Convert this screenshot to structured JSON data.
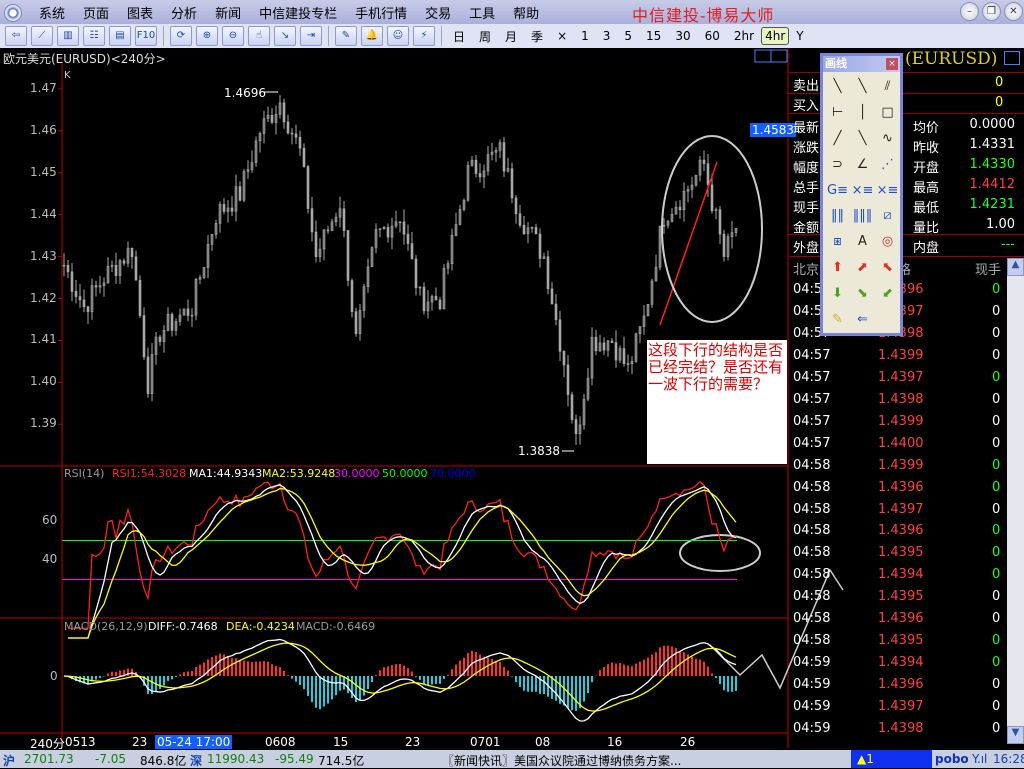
{
  "app": {
    "title": "中信建投-博易大师",
    "menu": [
      "系统",
      "页面",
      "图表",
      "分析",
      "新闻",
      "中信建投专栏",
      "手机行情",
      "交易",
      "工具",
      "帮助"
    ]
  },
  "toolbar": {
    "icons": [
      "back-icon",
      "line-chart-icon",
      "kline-icon",
      "table-icon",
      "report-icon",
      "f10-icon",
      "refresh-icon",
      "zoom-in-icon",
      "zoom-out-icon",
      "cursor-icon",
      "window-arrow-icon",
      "export-icon",
      "draw-icon",
      "alarm-icon",
      "users-icon",
      "lightning-icon"
    ],
    "f10_label": "F10",
    "periods": [
      "日",
      "周",
      "月",
      "季",
      "×",
      "1",
      "3",
      "5",
      "15",
      "30",
      "60",
      "2hr",
      "4hr",
      "Y"
    ],
    "selected_period": "4hr"
  },
  "chart": {
    "symbol_title": "欧元美元(EURUSD)<240分>",
    "k_label": "K",
    "y_ticks": [
      "1.47",
      "1.46",
      "1.45",
      "1.44",
      "1.43",
      "1.42",
      "1.41",
      "1.40",
      "1.39"
    ],
    "high_label": "1.4696",
    "low_label": "1.3838",
    "last_price_tag": "1.4583",
    "x_period_label": "240分",
    "x_ticks": [
      "0513",
      "23",
      "05-24 17:00",
      "0608",
      "15",
      "23",
      "0701",
      "08",
      "16",
      "26"
    ],
    "annotation": "这段下行的结构是否已经完结？是否还有一波下行的需要？",
    "colors": {
      "candle": "#a8a8a8",
      "axis": "#c00000",
      "trendline": "#ff2020"
    }
  },
  "chart_data": {
    "type": "candlestick",
    "note_points": "approximate price path (bar index, price)",
    "waypoints": [
      [
        0,
        1.428
      ],
      [
        5,
        1.418
      ],
      [
        10,
        1.425
      ],
      [
        17,
        1.432
      ],
      [
        21,
        1.4
      ],
      [
        24,
        1.412
      ],
      [
        32,
        1.418
      ],
      [
        38,
        1.44
      ],
      [
        44,
        1.445
      ],
      [
        49,
        1.46
      ],
      [
        54,
        1.467
      ],
      [
        59,
        1.455
      ],
      [
        63,
        1.43
      ],
      [
        69,
        1.443
      ],
      [
        73,
        1.41
      ],
      [
        78,
        1.435
      ],
      [
        84,
        1.44
      ],
      [
        89,
        1.42
      ],
      [
        94,
        1.42
      ],
      [
        101,
        1.45
      ],
      [
        109,
        1.455
      ],
      [
        114,
        1.44
      ],
      [
        120,
        1.43
      ],
      [
        125,
        1.405
      ],
      [
        128,
        1.386
      ],
      [
        132,
        1.41
      ],
      [
        137,
        1.41
      ],
      [
        141,
        1.403
      ],
      [
        145,
        1.415
      ],
      [
        150,
        1.44
      ],
      [
        155,
        1.445
      ],
      [
        160,
        1.452
      ],
      [
        165,
        1.43
      ],
      [
        168,
        1.437
      ]
    ],
    "ylim": [
      1.385,
      1.472
    ]
  },
  "rsi": {
    "label": "RSI(14)",
    "rsi1": "RSI1:54.3028",
    "ma1": "MA1:44.9343",
    "ma2": "MA2:53.9248",
    "l30": "30.0000",
    "l50": "50.0000",
    "l70": "70.0000",
    "ticks": [
      "60",
      "40"
    ]
  },
  "macd": {
    "label": "MACD(26,12,9)",
    "diff": "DIFF:-0.7468",
    "dea": "DEA:-0.4234",
    "macd": "MACD:-0.6469",
    "ticks": [
      "0"
    ]
  },
  "quote": {
    "symbol": "(EURUSD)",
    "rows": [
      {
        "l": "卖出",
        "v": "0"
      },
      {
        "l": "买入",
        "v": "0"
      }
    ],
    "stats": [
      {
        "l": "最新",
        "l2": "均价",
        "v": "0.0000",
        "c": "#fff"
      },
      {
        "l": "涨跌",
        "l2": "昨收",
        "v": "1.4331",
        "c": "#fff"
      },
      {
        "l": "幅度",
        "l2": "开盘",
        "v": "1.4330",
        "c": "#20ff20"
      },
      {
        "l": "总手",
        "l2": "最高",
        "v": "1.4412",
        "c": "#ff4040"
      },
      {
        "l": "现手",
        "l2": "最低",
        "v": "1.4231",
        "c": "#20ff20"
      },
      {
        "l": "金额",
        "l2": "量比",
        "v": "1.00",
        "c": "#fff"
      }
    ],
    "outer": "外盘",
    "inner": "内盘",
    "inner_v": "---",
    "tick_header": [
      "北京",
      "价格",
      "现手"
    ],
    "ticks": [
      [
        "04:57",
        "1.4396",
        "0",
        "g"
      ],
      [
        "04:57",
        "1.4397",
        "0",
        "w"
      ],
      [
        "04:57",
        "1.4398",
        "0",
        "w"
      ],
      [
        "04:57",
        "1.4399",
        "0",
        "w"
      ],
      [
        "04:57",
        "1.4397",
        "0",
        "g"
      ],
      [
        "04:57",
        "1.4398",
        "0",
        "w"
      ],
      [
        "04:57",
        "1.4399",
        "0",
        "w"
      ],
      [
        "04:57",
        "1.4400",
        "0",
        "w"
      ],
      [
        "04:58",
        "1.4399",
        "0",
        "g"
      ],
      [
        "04:58",
        "1.4396",
        "0",
        "g"
      ],
      [
        "04:58",
        "1.4397",
        "0",
        "w"
      ],
      [
        "04:58",
        "1.4396",
        "0",
        "g"
      ],
      [
        "04:58",
        "1.4395",
        "0",
        "g"
      ],
      [
        "04:58",
        "1.4394",
        "0",
        "g"
      ],
      [
        "04:58",
        "1.4395",
        "0",
        "w"
      ],
      [
        "04:58",
        "1.4396",
        "0",
        "w"
      ],
      [
        "04:58",
        "1.4395",
        "0",
        "g"
      ],
      [
        "04:59",
        "1.4394",
        "0",
        "g"
      ],
      [
        "04:59",
        "1.4396",
        "0",
        "w"
      ],
      [
        "04:59",
        "1.4397",
        "0",
        "w"
      ],
      [
        "04:59",
        "1.4398",
        "0",
        "w"
      ]
    ]
  },
  "toolbox": {
    "title": "画线",
    "close": "×",
    "tools": [
      "╲",
      "╲",
      "⫽",
      "⊢",
      "│",
      "□",
      "╱",
      "╲",
      "∿",
      "⊃",
      "∠",
      "⋰",
      "G≡",
      "×≡",
      "×≡",
      "‖‖",
      "‖‖‖",
      "⧄",
      "⧆",
      "A",
      "◎",
      "⬆",
      "⬈",
      "⬉",
      "⬇",
      "⬊",
      "⬋",
      "✎",
      "⇐"
    ]
  },
  "status": {
    "sh_label": "沪",
    "sh_index": "2701.73",
    "sh_change": "-7.05",
    "sh_amount": "846.8亿",
    "sz_label": "深",
    "sz_index": "11990.43",
    "sz_change": "-95.49",
    "sz_amount": "714.5亿",
    "news": "〖新闻快讯〗美国众议院通过博纳债务方案...",
    "alert": "▲1",
    "brand": "pobo",
    "time": "16:28"
  }
}
